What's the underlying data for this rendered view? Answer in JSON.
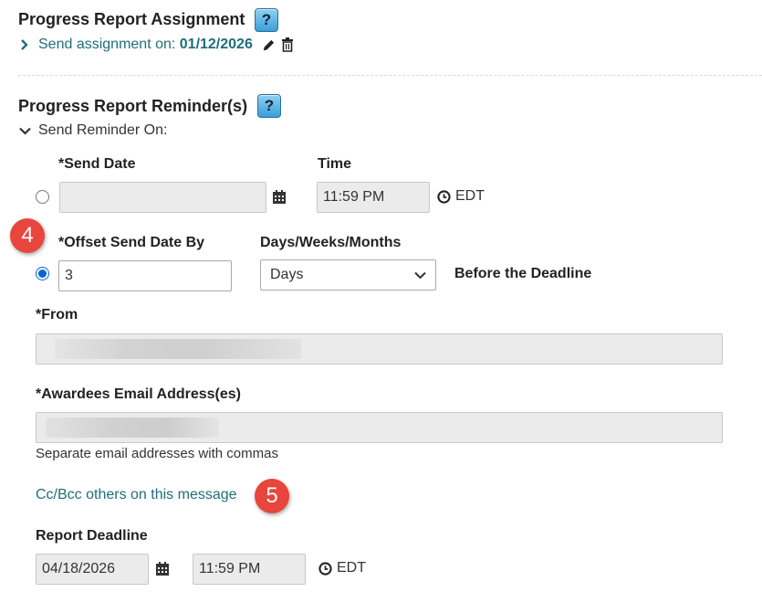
{
  "assignment": {
    "title": "Progress Report Assignment",
    "help_label": "?",
    "send_prefix": "Send assignment on: ",
    "send_date": "01/12/2026"
  },
  "reminders": {
    "title": "Progress Report Reminder(s)",
    "help_label": "?",
    "send_on_label": "Send Reminder On:",
    "send_date_label": "*Send Date",
    "send_date_value": "",
    "time_label": "Time",
    "time_value": "11:59 PM",
    "timezone": "EDT",
    "offset_label": "*Offset Send Date By",
    "offset_value": "3",
    "unit_label": "Days/Weeks/Months",
    "unit_selected": "Days",
    "relation": "Before the Deadline",
    "from_label": "*From",
    "awardees_label": "*Awardees Email Address(es)",
    "awardees_hint": "Separate email addresses with commas",
    "cc_link": "Cc/Bcc others on this message",
    "deadline_label": "Report Deadline",
    "deadline_date": "04/18/2026",
    "deadline_time": "11:59 PM",
    "deadline_timezone": "EDT"
  },
  "badges": {
    "step4": "4",
    "step5": "5"
  },
  "colors": {
    "link": "#1f6e7a",
    "badge": "#e8453c",
    "radio_checked": "#0b63d6"
  }
}
